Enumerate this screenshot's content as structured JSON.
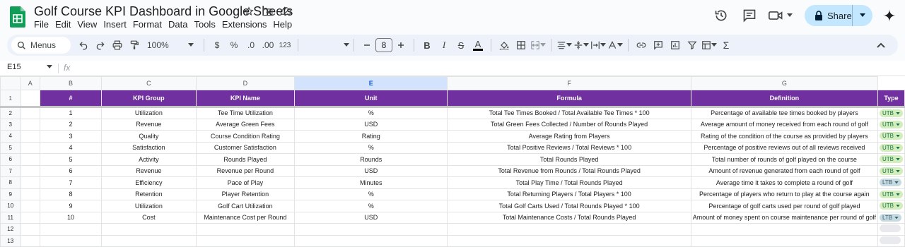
{
  "app": {
    "title": "Golf Course KPI Dashboard in Google Sheets",
    "menu": [
      "File",
      "Edit",
      "View",
      "Insert",
      "Format",
      "Data",
      "Tools",
      "Extensions",
      "Help"
    ],
    "share_label": "Share",
    "brand_color": "#0f9d58",
    "accent_color": "#7030a0"
  },
  "toolbar": {
    "menus_label": "Menus",
    "zoom": "100%",
    "currency": "$",
    "percent": "%",
    "dec_decrease": ".0",
    "dec_increase": ".00",
    "number_format": "123",
    "font_size": "8"
  },
  "formula_bar": {
    "name_box": "E15",
    "fx": "fx"
  },
  "sheet": {
    "columns": [
      "A",
      "B",
      "C",
      "D",
      "E",
      "F",
      "G"
    ],
    "selected_column": "E",
    "row_numbers": [
      "1",
      "2",
      "3",
      "4",
      "5",
      "6",
      "7",
      "8",
      "9",
      "10",
      "11",
      "12",
      "13"
    ],
    "header": [
      "#",
      "KPI Group",
      "KPI Name",
      "Unit",
      "Formula",
      "Definition",
      "Type"
    ],
    "rows": [
      [
        "1",
        "Utilization",
        "Tee Time Utilization",
        "%",
        "Total Tee Times Booked / Total Available Tee Times * 100",
        "Percentage of available tee times booked by players",
        "UTB"
      ],
      [
        "2",
        "Revenue",
        "Average Green Fees",
        "USD",
        "Total Green Fees Collected / Number of Rounds Played",
        "Average amount of money received from each round of golf",
        "UTB"
      ],
      [
        "3",
        "Quality",
        "Course Condition Rating",
        "Rating",
        "Average Rating from Players",
        "Rating of the condition of the course as provided by players",
        "UTB"
      ],
      [
        "4",
        "Satisfaction",
        "Customer Satisfaction",
        "%",
        "Total Positive Reviews / Total Reviews * 100",
        "Percentage of positive reviews out of all reviews received",
        "UTB"
      ],
      [
        "5",
        "Activity",
        "Rounds Played",
        "Rounds",
        "Total Rounds Played",
        "Total number of rounds of golf played on the course",
        "UTB"
      ],
      [
        "6",
        "Revenue",
        "Revenue per Round",
        "USD",
        "Total Revenue from Rounds / Total Rounds Played",
        "Amount of revenue generated from each round of golf",
        "UTB"
      ],
      [
        "7",
        "Efficiency",
        "Pace of Play",
        "Minutes",
        "Total Play Time / Total Rounds Played",
        "Average time it takes to complete a round of golf",
        "LTB"
      ],
      [
        "8",
        "Retention",
        "Player Retention",
        "%",
        "Total Returning Players / Total Players * 100",
        "Percentage of players who return to play at the course again",
        "UTB"
      ],
      [
        "9",
        "Utilization",
        "Golf Cart Utilization",
        "%",
        "Total Golf Carts Used / Total Rounds Played * 100",
        "Percentage of golf carts used per round of golf played",
        "UTB"
      ],
      [
        "10",
        "Cost",
        "Maintenance Cost per Round",
        "USD",
        "Total Maintenance Costs / Total Rounds Played",
        "Amount of money spent on course maintenance per round of golf",
        "LTB"
      ]
    ]
  }
}
